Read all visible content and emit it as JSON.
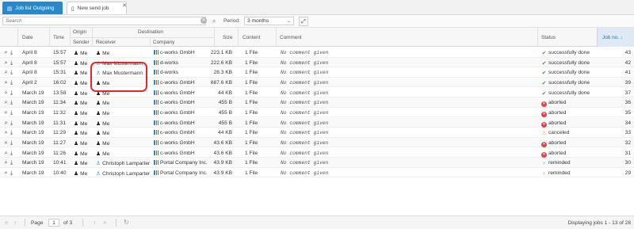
{
  "tabs": [
    {
      "label": "Job list Outgoing",
      "active": true
    },
    {
      "label": "New send job",
      "active": false
    }
  ],
  "toolbar": {
    "search_placeholder": "Search",
    "period_label": "Period:",
    "period_value": "3 months"
  },
  "headers": {
    "date": "Date",
    "time": "Time",
    "origin": "Origin",
    "sender": "Sender",
    "destination": "Destination",
    "receiver": "Receiver",
    "company": "Company",
    "size": "Size",
    "content": "Content",
    "comment": "Comment",
    "status": "Status",
    "job_no": "Job no. ↓"
  },
  "rows": [
    {
      "date": "April 8",
      "time": "15:57",
      "sender": "Me",
      "receiver": "Me",
      "receiver_type": "user",
      "company": "c-works GmbH",
      "size": "223.1 KB",
      "content": "1 File",
      "comment": "No comment given",
      "status": "successfully done",
      "status_type": "done",
      "job": "43"
    },
    {
      "date": "April 8",
      "time": "15:57",
      "sender": "Me",
      "receiver": "Max Mustermann",
      "receiver_type": "external",
      "company": "d-works",
      "size": "222.6 KB",
      "content": "1 File",
      "comment": "No comment given",
      "status": "successfully done",
      "status_type": "done",
      "job": "42"
    },
    {
      "date": "April 8",
      "time": "15:31",
      "sender": "Me",
      "receiver": "Max Mustermann",
      "receiver_type": "external",
      "company": "d-works",
      "size": "28.3 KB",
      "content": "1 File",
      "comment": "No comment given",
      "status": "successfully done",
      "status_type": "done",
      "job": "41"
    },
    {
      "date": "April 2",
      "time": "16:02",
      "sender": "Me",
      "receiver": "Me",
      "receiver_type": "user",
      "company": "c-works GmbH",
      "size": "687.6 KB",
      "content": "1 File",
      "comment": "No comment given",
      "status": "successfully done",
      "status_type": "done",
      "job": "39"
    },
    {
      "date": "March 19",
      "time": "13:58",
      "sender": "Me",
      "receiver": "Me",
      "receiver_type": "user",
      "company": "c-works GmbH",
      "size": "44 KB",
      "content": "1 File",
      "comment": "No comment given",
      "status": "successfully done",
      "status_type": "done",
      "job": "37"
    },
    {
      "date": "March 19",
      "time": "11:34",
      "sender": "Me",
      "receiver": "Me",
      "receiver_type": "user",
      "company": "c-works GmbH",
      "size": "455 B",
      "content": "1 File",
      "comment": "No comment given",
      "status": "aborted",
      "status_type": "aborted",
      "job": "36"
    },
    {
      "date": "March 19",
      "time": "11:32",
      "sender": "Me",
      "receiver": "Me",
      "receiver_type": "user",
      "company": "c-works GmbH",
      "size": "455 B",
      "content": "1 File",
      "comment": "No comment given",
      "status": "aborted",
      "status_type": "aborted",
      "job": "35"
    },
    {
      "date": "March 19",
      "time": "11:31",
      "sender": "Me",
      "receiver": "Me",
      "receiver_type": "user",
      "company": "c-works GmbH",
      "size": "455 B",
      "content": "1 File",
      "comment": "No comment given",
      "status": "aborted",
      "status_type": "aborted",
      "job": "34"
    },
    {
      "date": "March 19",
      "time": "11:29",
      "sender": "Me",
      "receiver": "Me",
      "receiver_type": "user",
      "company": "c-works GmbH",
      "size": "44 KB",
      "content": "1 File",
      "comment": "No comment given",
      "status": "canceled",
      "status_type": "canceled",
      "job": "33"
    },
    {
      "date": "March 19",
      "time": "11:27",
      "sender": "Me",
      "receiver": "Me",
      "receiver_type": "user",
      "company": "c-works GmbH",
      "size": "43.6 KB",
      "content": "1 File",
      "comment": "No comment given",
      "status": "aborted",
      "status_type": "aborted",
      "job": "32"
    },
    {
      "date": "March 19",
      "time": "11:26",
      "sender": "Me",
      "receiver": "Me",
      "receiver_type": "user",
      "company": "c-works GmbH",
      "size": "43.6 KB",
      "content": "1 File",
      "comment": "No comment given",
      "status": "aborted",
      "status_type": "aborted",
      "job": "31"
    },
    {
      "date": "March 19",
      "time": "10:41",
      "sender": "Me",
      "receiver": "Christoph Lamparter",
      "receiver_type": "external",
      "company": "Portal Company Inc.",
      "size": "43.9 KB",
      "content": "1 File",
      "comment": "No comment given",
      "status": "reminded",
      "status_type": "reminded",
      "job": "30"
    },
    {
      "date": "March 19",
      "time": "10:40",
      "sender": "Me",
      "receiver": "Christoph Lamparter",
      "receiver_type": "external",
      "company": "Portal Company Inc.",
      "size": "43.9 KB",
      "content": "1 File",
      "comment": "No comment given",
      "status": "reminded",
      "status_type": "reminded",
      "job": "29"
    }
  ],
  "pager": {
    "page_label": "Page",
    "page_value": "1",
    "of_label": "of 3",
    "display_text": "Displaying jobs 1 - 13 of 28"
  },
  "colors": {
    "accent": "#2a88c8",
    "done": "#3aa64c",
    "aborted": "#d9434a",
    "canceled": "#f0a22a",
    "highlight": "#e02a2a"
  }
}
